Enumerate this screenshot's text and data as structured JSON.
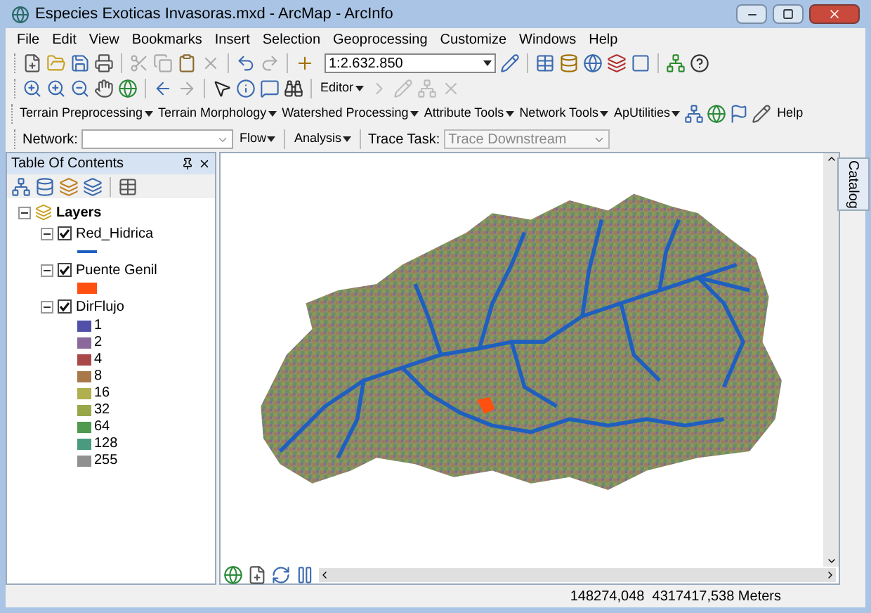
{
  "window": {
    "title": "Especies Exoticas Invasoras.mxd - ArcMap - ArcInfo"
  },
  "menu": [
    "File",
    "Edit",
    "View",
    "Bookmarks",
    "Insert",
    "Selection",
    "Geoprocessing",
    "Customize",
    "Windows",
    "Help"
  ],
  "standard_toolbar": {
    "scale": "1:2.632.850"
  },
  "tools_toolbar": {
    "editor": "Editor"
  },
  "hydro_toolbar": {
    "menus": [
      "Terrain Preprocessing",
      "Terrain Morphology",
      "Watershed Processing",
      "Attribute Tools",
      "Network Tools",
      "ApUtilities"
    ],
    "help": "Help"
  },
  "network_toolbar": {
    "network_label": "Network:",
    "flow": "Flow",
    "analysis": "Analysis",
    "trace_label": "Trace Task:",
    "trace_value": "Trace Downstream"
  },
  "toc": {
    "title": "Table Of Contents",
    "root": {
      "label": "Layers",
      "expanded": true,
      "children": [
        {
          "label": "Red_Hidrica",
          "checked": true,
          "expanded": true,
          "kind": "line",
          "color": "#1f5fbf"
        },
        {
          "label": "Puente Genil",
          "checked": true,
          "expanded": true,
          "kind": "fill",
          "color": "#ff5010"
        },
        {
          "label": "DirFlujo",
          "checked": true,
          "expanded": true,
          "kind": "classes",
          "classes": [
            {
              "label": "1",
              "color": "#5050a8"
            },
            {
              "label": "2",
              "color": "#8a6a9a"
            },
            {
              "label": "4",
              "color": "#a84848"
            },
            {
              "label": "8",
              "color": "#a87848"
            },
            {
              "label": "16",
              "color": "#b0b050"
            },
            {
              "label": "32",
              "color": "#98a848"
            },
            {
              "label": "64",
              "color": "#4f9a4f"
            },
            {
              "label": "128",
              "color": "#4a9a80"
            },
            {
              "label": "255",
              "color": "#909090"
            }
          ]
        }
      ]
    }
  },
  "catalog_tab": "Catalog",
  "status_bar": {
    "coordinates": "148274,048  4317417,538 Meters"
  }
}
